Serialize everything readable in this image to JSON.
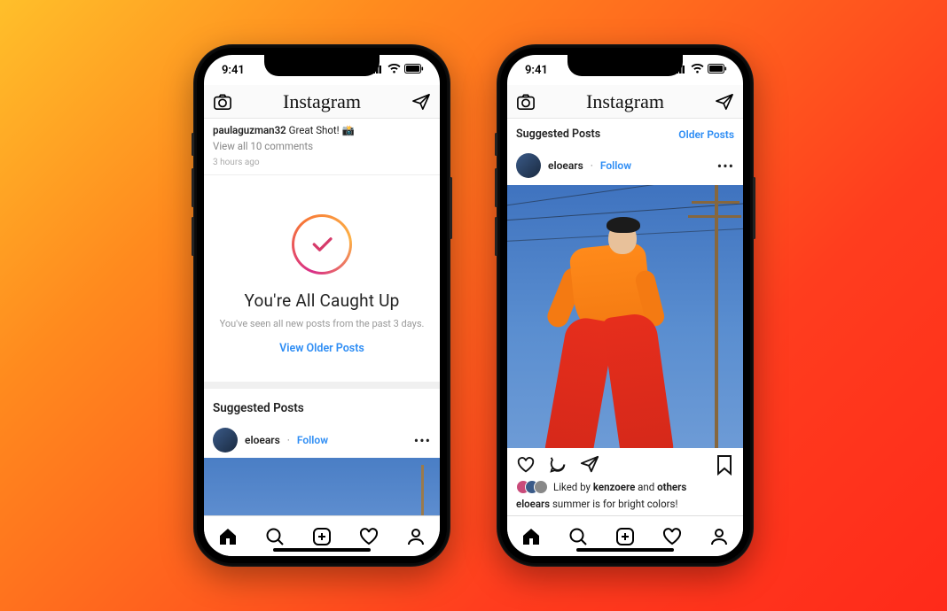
{
  "status": {
    "time": "9:41"
  },
  "brand": "Instagram",
  "left": {
    "comment": {
      "user": "paulaguzman32",
      "text": "Great Shot! 📸"
    },
    "view_all": "View all 10 comments",
    "timeago": "3 hours ago",
    "caughtup": {
      "title": "You're All Caught Up",
      "sub": "You've seen all new posts from the past 3 days.",
      "cta": "View Older Posts"
    },
    "suggested_header": "Suggested Posts",
    "post": {
      "user": "eloears",
      "follow": "Follow"
    }
  },
  "right": {
    "suggested_header": "Suggested Posts",
    "older_link": "Older Posts",
    "post": {
      "user": "eloears",
      "follow": "Follow",
      "liked_prefix": "Liked by ",
      "liked_name": "kenzoere",
      "liked_suffix": " and ",
      "liked_others": "others",
      "caption": "summer is for bright colors!"
    }
  },
  "sep": " · "
}
